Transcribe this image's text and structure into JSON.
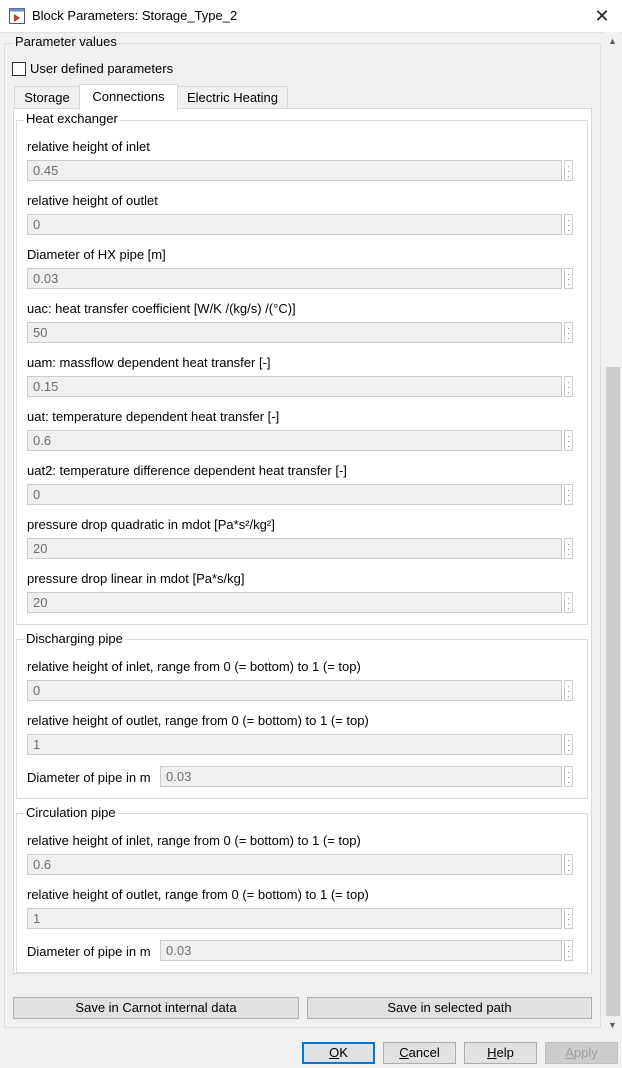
{
  "window": {
    "title": "Block Parameters: Storage_Type_2",
    "close": "✕"
  },
  "params": {
    "group_title": "Parameter values",
    "user_defined_label": "User defined parameters",
    "user_defined_checked": false
  },
  "tabs": [
    {
      "label": "Storage",
      "active": false
    },
    {
      "label": "Connections",
      "active": true
    },
    {
      "label": "Electric Heating",
      "active": false
    }
  ],
  "heat_exchanger": {
    "title": "Heat exchanger",
    "fields": [
      {
        "label": "relative height of inlet",
        "value": "0.45"
      },
      {
        "label": "relative height of outlet",
        "value": "0"
      },
      {
        "label": "Diameter of HX pipe [m]",
        "value": "0.03"
      },
      {
        "label": "uac: heat transfer coefficient [W/K /(kg/s) /(°C)]",
        "value": "50"
      },
      {
        "label": "uam: massflow dependent heat transfer [-]",
        "value": "0.15"
      },
      {
        "label": "uat: temperature dependent heat transfer [-]",
        "value": "0.6"
      },
      {
        "label": "uat2: temperature difference dependent heat transfer [-]",
        "value": "0"
      },
      {
        "label": "pressure drop quadratic in mdot [Pa*s²/kg²]",
        "value": "20"
      },
      {
        "label": "pressure drop linear in mdot [Pa*s/kg]",
        "value": "20"
      }
    ]
  },
  "discharging_pipe": {
    "title": "Discharging pipe",
    "inlet_label": "relative height of inlet, range from 0 (= bottom) to 1 (= top)",
    "inlet_value": "0",
    "outlet_label": "relative height of outlet, range from 0 (= bottom) to 1 (= top)",
    "outlet_value": "1",
    "diameter_label": "Diameter of pipe in m",
    "diameter_value": "0.03"
  },
  "circulation_pipe": {
    "title": "Circulation pipe",
    "inlet_label": "relative height of inlet, range from 0 (= bottom) to 1 (= top)",
    "inlet_value": "0.6",
    "outlet_label": "relative height of outlet, range from 0 (= bottom) to 1 (= top)",
    "outlet_value": "1",
    "diameter_label": "Diameter of pipe in m",
    "diameter_value": "0.03"
  },
  "save_buttons": {
    "carnot": "Save in Carnot internal data",
    "path": "Save in selected path"
  },
  "dialog_buttons": {
    "ok_prefix": "",
    "ok_mnemonic": "O",
    "ok_rest": "K",
    "cancel_prefix": "",
    "cancel_mnemonic": "C",
    "cancel_rest": "ancel",
    "help_prefix": "",
    "help_mnemonic": "H",
    "help_rest": "elp",
    "apply_prefix": "",
    "apply_mnemonic": "A",
    "apply_rest": "pply"
  },
  "scrollbar": {
    "up": "▲",
    "down": "▼",
    "position": 0.33
  },
  "colors": {
    "ok_border": "#0078d7",
    "field_bg": "#f0f0f0",
    "panel_bg": "#ffffff"
  }
}
